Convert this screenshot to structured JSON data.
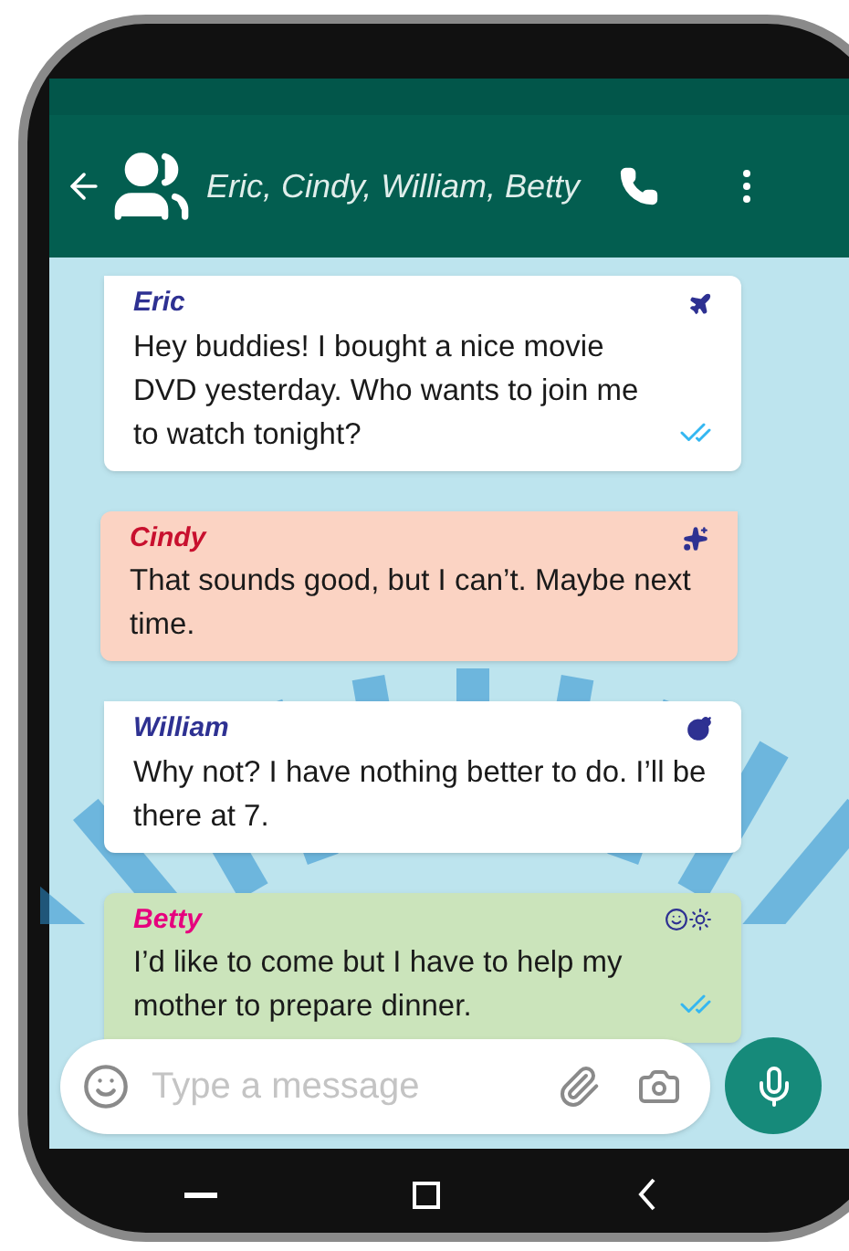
{
  "header": {
    "title": "Eric, Cindy, William, Betty"
  },
  "messages": [
    {
      "sender": "Eric",
      "color": "#2e3192",
      "text": "Hey buddies! I bought a nice movie DVD yesterday. Who wants to join me to watch tonight?",
      "kind": "left",
      "read": true
    },
    {
      "sender": "Cindy",
      "color": "#c8102e",
      "text": "That sounds good, but I can’t. Maybe next time.",
      "kind": "right",
      "read": false
    },
    {
      "sender": "William",
      "color": "#2e3192",
      "text": "Why not? I have nothing better to do. I’ll be there at 7.",
      "kind": "left",
      "read": false
    },
    {
      "sender": "Betty",
      "color": "#e6007e",
      "text": "I’d like to come but I have to help my mother to prepare dinner.",
      "kind": "bottomleft",
      "read": true
    }
  ],
  "composer": {
    "placeholder": "Type a message"
  }
}
